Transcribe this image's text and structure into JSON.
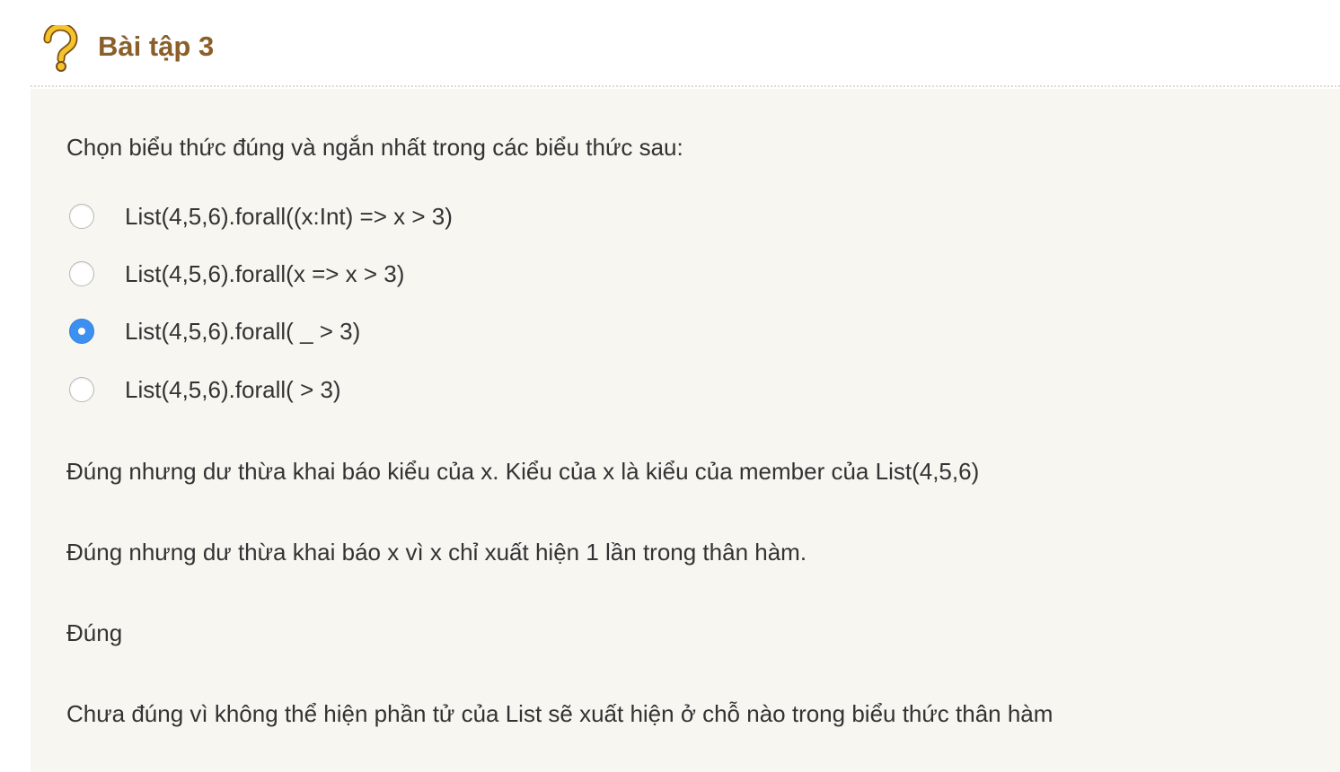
{
  "exercise": {
    "title": "Bài tập 3",
    "icon": "question-mark-icon",
    "colors": {
      "title": "#8a5f2a",
      "panel_background": "#f7f6f1",
      "radio_selected": "#3d8ff0",
      "icon": "#f5c42c"
    }
  },
  "question": {
    "prompt": "Chọn biểu thức đúng và ngắn nhất trong các biểu thức sau:",
    "options": [
      {
        "label": "List(4,5,6).forall((x:Int) => x > 3)",
        "selected": false
      },
      {
        "label": "List(4,5,6).forall(x => x > 3)",
        "selected": false
      },
      {
        "label": "List(4,5,6).forall( _ > 3)",
        "selected": true
      },
      {
        "label": "List(4,5,6).forall( > 3)",
        "selected": false
      }
    ]
  },
  "feedback": [
    "Đúng nhưng dư thừa khai báo kiểu của x. Kiểu của x là kiểu của member của List(4,5,6)",
    "Đúng nhưng dư thừa khai báo x vì x chỉ xuất hiện 1 lần trong thân hàm.",
    "Đúng",
    "Chưa đúng vì không thể hiện phần tử của List sẽ xuất hiện ở chỗ nào trong biểu thức thân hàm"
  ]
}
